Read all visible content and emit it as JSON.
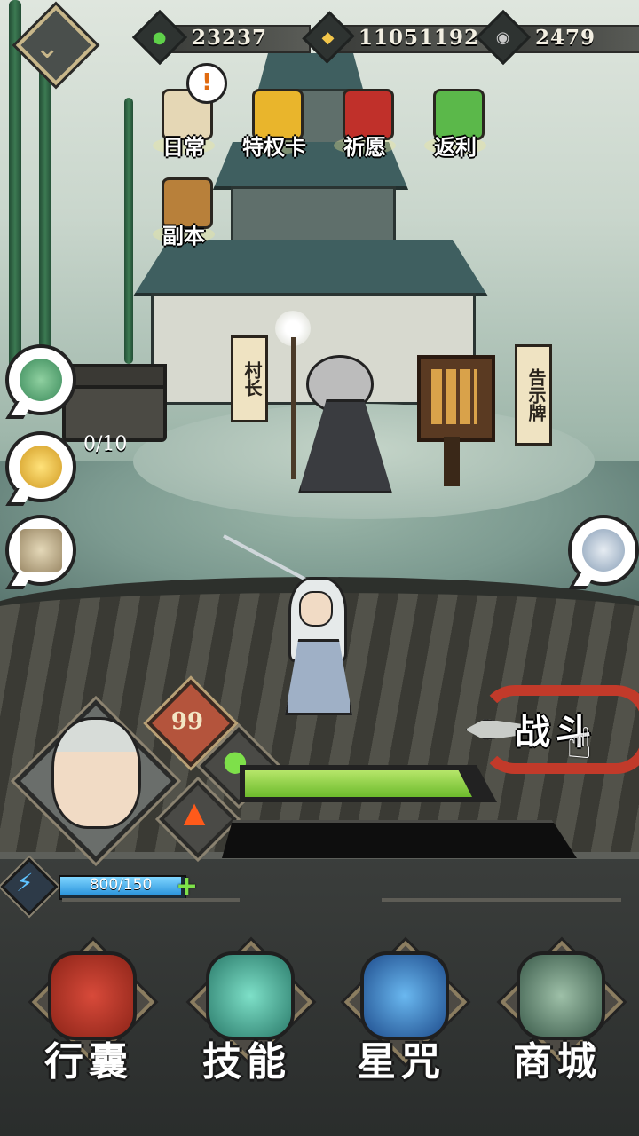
{
  "currencies": [
    {
      "name": "jade",
      "value": "23237",
      "icon": "green-flame-icon",
      "color": "#5fd14a"
    },
    {
      "name": "gold",
      "value": "11051192",
      "icon": "gold-coin-icon",
      "color": "#f2c64a"
    },
    {
      "name": "silver",
      "value": "2479",
      "icon": "silver-coin-icon",
      "color": "#c9c9c9"
    }
  ],
  "events": [
    {
      "label": "日常",
      "icon": "scroll-icon"
    },
    {
      "label": "特权卡",
      "icon": "privilege-card-icon"
    },
    {
      "label": "祈愿",
      "icon": "shrine-gate-icon"
    },
    {
      "label": "返利",
      "icon": "treasure-chest-icon"
    },
    {
      "label": "副本",
      "icon": "samurai-helmet-icon"
    }
  ],
  "alert_badge": "!",
  "signs": {
    "village_chief": "村长",
    "notice_board": "告示牌"
  },
  "chest_counter": "0/10",
  "player": {
    "level": "99",
    "hp_fraction": 0.92,
    "mp_fraction": 0.0,
    "energy_text": "800/150",
    "energy_fraction": 1.0
  },
  "battle_label": "战斗",
  "nav": [
    {
      "label": "行囊",
      "icon": "bag-icon"
    },
    {
      "label": "技能",
      "icon": "dragon-blade-icon"
    },
    {
      "label": "星咒",
      "icon": "star-scroll-icon"
    },
    {
      "label": "商城",
      "icon": "shop-icon"
    }
  ],
  "colors": {
    "hp": "#8fd43b",
    "energy": "#3aa6ea",
    "battle_ribbon": "#c23a2a",
    "gold_trim": "#c8b78a"
  }
}
